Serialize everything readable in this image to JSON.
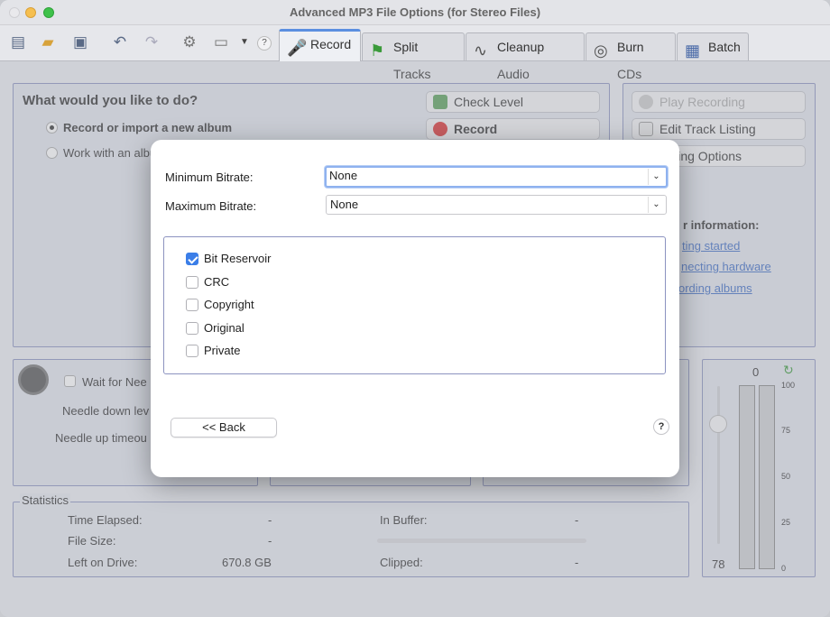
{
  "window": {
    "title": "Advanced MP3 File Options (for Stereo Files)"
  },
  "toolbar": {
    "help_icon_label": "?",
    "tabs": [
      {
        "label": "Record",
        "icon": "microphone-icon"
      },
      {
        "label": "Split Tracks",
        "icon": "flags-icon"
      },
      {
        "label": "Cleanup Audio",
        "icon": "waveform-icon"
      },
      {
        "label": "Burn CDs",
        "icon": "disc-icon"
      },
      {
        "label": "Batch",
        "icon": "batch-icon"
      }
    ]
  },
  "background": {
    "question": "What would you like to do?",
    "radio_record": "Record or import a new album",
    "radio_work": "Work with an albu",
    "btn_check_level": "Check Level",
    "btn_record": "Record",
    "btn_play": "Play Recording",
    "btn_edit": "Edit Track Listing",
    "btn_options": "ording Options",
    "info_heading": "r information:",
    "links": [
      "ting started",
      "necting hardware",
      "ording albums"
    ],
    "wait_label": "Wait for Nee",
    "needle_down": "Needle down lev",
    "needle_up": "Needle up timeou",
    "statistics": {
      "legend": "Statistics",
      "time_elapsed_label": "Time Elapsed:",
      "time_elapsed_value": "-",
      "file_size_label": "File Size:",
      "file_size_value": "-",
      "left_on_drive_label": "Left on Drive:",
      "left_on_drive_value": "670.8 GB",
      "in_buffer_label": "In Buffer:",
      "in_buffer_value": "-",
      "clipped_label": "Clipped:",
      "clipped_value": "-"
    },
    "meter": {
      "top_value": "0",
      "bottom_value": "78",
      "ticks": [
        "100",
        "75",
        "50",
        "25",
        "0"
      ]
    }
  },
  "modal": {
    "min_bitrate_label": "Minimum Bitrate:",
    "min_bitrate_value": "None",
    "max_bitrate_label": "Maximum Bitrate:",
    "max_bitrate_value": "None",
    "options": [
      {
        "label": "Bit Reservoir",
        "checked": true
      },
      {
        "label": "CRC",
        "checked": false
      },
      {
        "label": "Copyright",
        "checked": false
      },
      {
        "label": "Original",
        "checked": false
      },
      {
        "label": "Private",
        "checked": false
      }
    ],
    "back_label": "<< Back",
    "help_label": "?"
  },
  "colors": {
    "accent": "#3b7ee8",
    "link": "#3f6ec6",
    "panel_border": "#8c93c0"
  }
}
